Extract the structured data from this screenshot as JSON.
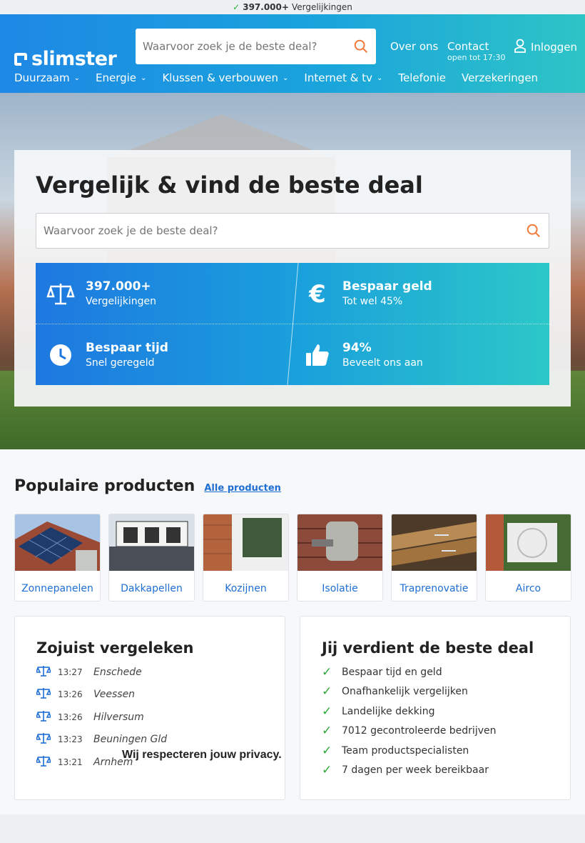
{
  "topbar": {
    "count": "397.000+",
    "label": "Vergelijkingen"
  },
  "header": {
    "logo": "slimster",
    "search_placeholder": "Waarvoor zoek je de beste deal?",
    "about": "Over ons",
    "contact": "Contact",
    "contact_sub": "open tot 17:30",
    "login": "Inloggen",
    "accent": "#1e88e5"
  },
  "nav": [
    {
      "label": "Duurzaam",
      "dropdown": true
    },
    {
      "label": "Energie",
      "dropdown": true
    },
    {
      "label": "Klussen & verbouwen",
      "dropdown": true
    },
    {
      "label": "Internet & tv",
      "dropdown": true
    },
    {
      "label": "Telefonie",
      "dropdown": false
    },
    {
      "label": "Verzekeringen",
      "dropdown": false
    }
  ],
  "hero": {
    "title": "Vergelijk & vind de beste deal",
    "search_placeholder": "Waarvoor zoek je de beste deal?",
    "usps": [
      {
        "icon": "scale-icon",
        "title": "397.000+",
        "sub": "Vergelijkingen"
      },
      {
        "icon": "euro-icon",
        "title": "Bespaar geld",
        "sub": "Tot wel 45%"
      },
      {
        "icon": "clock-icon",
        "title": "Bespaar tijd",
        "sub": "Snel geregeld"
      },
      {
        "icon": "thumbs-up-icon",
        "title": "94%",
        "sub": "Beveelt ons aan"
      }
    ]
  },
  "popular": {
    "title": "Populaire producten",
    "all_link": "Alle producten",
    "products": [
      {
        "label": "Zonnepanelen"
      },
      {
        "label": "Dakkapellen"
      },
      {
        "label": "Kozijnen"
      },
      {
        "label": "Isolatie"
      },
      {
        "label": "Traprenovatie"
      },
      {
        "label": "Airco"
      }
    ]
  },
  "recent": {
    "title": "Zojuist vergeleken",
    "items": [
      {
        "time": "13:27",
        "city": "Enschede"
      },
      {
        "time": "13:26",
        "city": "Veessen"
      },
      {
        "time": "13:26",
        "city": "Hilversum"
      },
      {
        "time": "13:23",
        "city": "Beuningen Gld"
      },
      {
        "time": "13:21",
        "city": "Arnhem"
      }
    ],
    "privacy_notice": "Wij respecteren jouw privacy."
  },
  "deal": {
    "title": "Jij verdient de beste deal",
    "items": [
      "Bespaar tijd en geld",
      "Onafhankelijk vergelijken",
      "Landelijke dekking",
      "7012 gecontroleerde bedrijven",
      "Team productspecialisten",
      "7 dagen per week bereikbaar"
    ]
  }
}
